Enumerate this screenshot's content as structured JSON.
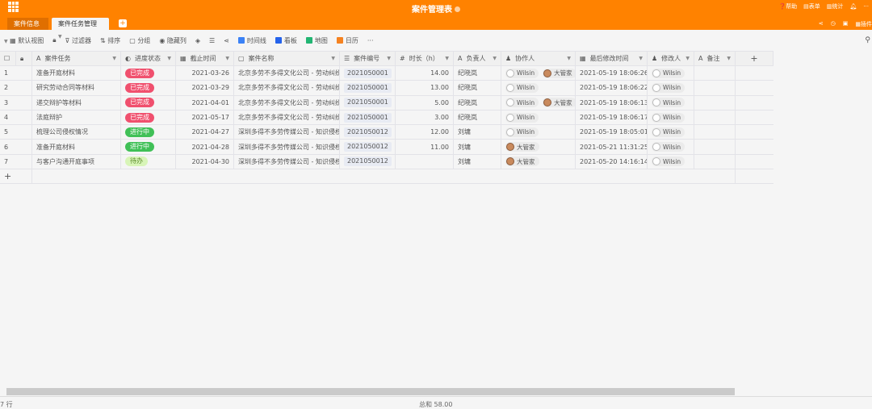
{
  "header": {
    "title": "案件管理表",
    "right_items": [
      "帮助",
      "表单",
      "统计"
    ],
    "right_icons": [
      "share-icon",
      "history-icon",
      "embed-icon"
    ],
    "plugins": "插件"
  },
  "tabs": [
    {
      "label": "案件信息"
    },
    {
      "label": "案件任务管理"
    }
  ],
  "toolbar": {
    "view": "默认视图",
    "filter": "过滤器",
    "sort": "排序",
    "group": "分组",
    "hide": "隐藏列",
    "timeline": "时间线",
    "kanban": "看板",
    "map": "地图",
    "calendar": "日历",
    "more": "···"
  },
  "columns": [
    "案件任务",
    "进度状态",
    "截止时间",
    "案件名称",
    "案件编号",
    "时长（h）",
    "负责人",
    "协作人",
    "最后修改时间",
    "修改人",
    "备注"
  ],
  "status_colors": {
    "已完成": "#f0506e",
    "进行中": "#40c057",
    "待办": "#d8f5b8"
  },
  "rows": [
    {
      "n": "1",
      "task": "准备开庭材料",
      "status": "已完成",
      "due": "2021-03-26",
      "case": "北京多劳不多得文化公司 - 劳动纠纷",
      "no": "2021050001",
      "hours": "14.00",
      "owner": "纪晓岚",
      "collab": [
        "Wilsin",
        "大管家"
      ],
      "modified": "2021-05-19 18:06:26",
      "editor": "Wilsin"
    },
    {
      "n": "2",
      "task": "研究劳动合同等材料",
      "status": "已完成",
      "due": "2021-03-29",
      "case": "北京多劳不多得文化公司 - 劳动纠纷",
      "no": "2021050001",
      "hours": "13.00",
      "owner": "纪晓岚",
      "collab": [
        "Wilsin"
      ],
      "modified": "2021-05-19 18:06:22",
      "editor": "Wilsin"
    },
    {
      "n": "3",
      "task": "递交辩护等材料",
      "status": "已完成",
      "due": "2021-04-01",
      "case": "北京多劳不多得文化公司 - 劳动纠纷",
      "no": "2021050001",
      "hours": "5.00",
      "owner": "纪晓岚",
      "collab": [
        "Wilsin",
        "大管家"
      ],
      "modified": "2021-05-19 18:06:13",
      "editor": "Wilsin"
    },
    {
      "n": "4",
      "task": "法庭辩护",
      "status": "已完成",
      "due": "2021-05-17",
      "case": "北京多劳不多得文化公司 - 劳动纠纷",
      "no": "2021050001",
      "hours": "3.00",
      "owner": "纪晓岚",
      "collab": [
        "Wilsin"
      ],
      "modified": "2021-05-19 18:06:17",
      "editor": "Wilsin"
    },
    {
      "n": "5",
      "task": "梳理公司侵权情况",
      "status": "进行中",
      "due": "2021-04-27",
      "case": "深圳多得不多劳传媒公司 - 知识侵权",
      "no": "2021050012",
      "hours": "12.00",
      "owner": "刘墉",
      "collab": [
        "Wilsin"
      ],
      "modified": "2021-05-19 18:05:01",
      "editor": "Wilsin"
    },
    {
      "n": "6",
      "task": "准备开庭材料",
      "status": "进行中",
      "due": "2021-04-28",
      "case": "深圳多得不多劳传媒公司 - 知识侵权",
      "no": "2021050012",
      "hours": "11.00",
      "owner": "刘墉",
      "collab": [
        "大管家"
      ],
      "modified": "2021-05-21 11:31:25",
      "editor": "Wilsin"
    },
    {
      "n": "7",
      "task": "与客户沟通开庭事项",
      "status": "待办",
      "due": "2021-04-30",
      "case": "深圳多得不多劳传媒公司 - 知识侵权",
      "no": "2021050012",
      "hours": "",
      "owner": "刘墉",
      "collab": [
        "大管家"
      ],
      "modified": "2021-05-20 14:16:14",
      "editor": "Wilsin"
    }
  ],
  "footer": {
    "rows": "7 行",
    "sum": "总和 58.00"
  }
}
